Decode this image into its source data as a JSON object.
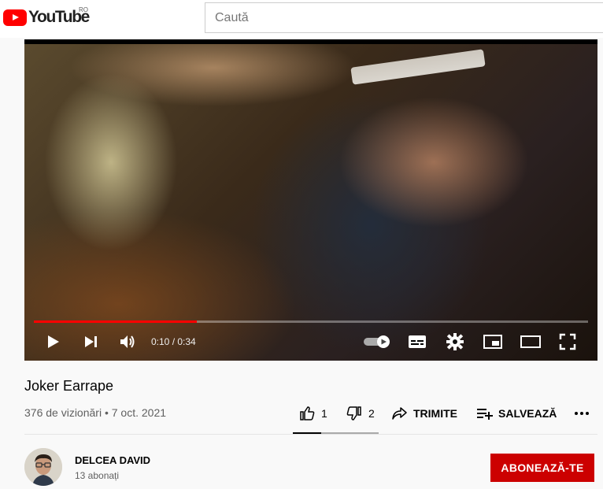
{
  "header": {
    "logo_text": "YouTube",
    "country_code": "RO",
    "search_placeholder": "Caută"
  },
  "player": {
    "time_current": "0:10",
    "time_total": "0:34",
    "time_display": "0:10 / 0:34",
    "progress_fraction": 0.294,
    "accent_color": "#ff0000"
  },
  "video": {
    "title": "Joker Earrape",
    "views": "376 de vizionări",
    "date": "7 oct. 2021",
    "meta_text": "376 de vizionări • 7 oct. 2021",
    "likes": "1",
    "dislikes": "2",
    "share_label": "TRIMITE",
    "save_label": "SALVEAZĂ",
    "like_ratio": 0.333
  },
  "channel": {
    "name": "DELCEA DAVID",
    "subscribers": "13 abonați",
    "subscribe_label": "ABONEAZĂ-TE",
    "subscribe_color": "#cc0000"
  },
  "icons": [
    "play-icon",
    "next-icon",
    "volume-icon",
    "autoplay-toggle-icon",
    "subtitles-icon",
    "settings-icon",
    "miniplayer-icon",
    "theater-icon",
    "fullscreen-icon",
    "like-icon",
    "dislike-icon",
    "share-icon",
    "save-icon",
    "more-icon"
  ]
}
